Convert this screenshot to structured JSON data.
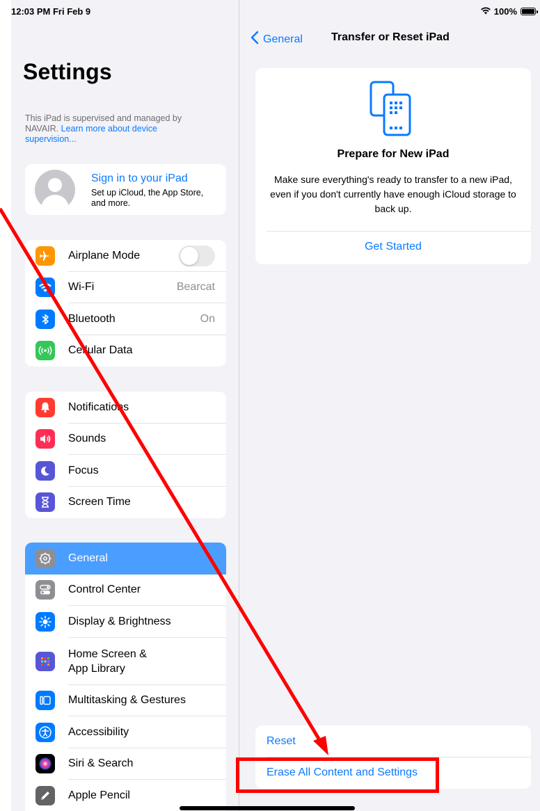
{
  "status_bar": {
    "time": "12:03 PM  Fri Feb 9",
    "battery": "100%"
  },
  "sidebar": {
    "title": "Settings",
    "supervision_text": "This iPad is supervised and managed by NAVAIR.",
    "supervision_link": "Learn more about device supervision...",
    "profile": {
      "title": "Sign in to your iPad",
      "subtitle": "Set up iCloud, the App Store, and more."
    },
    "group1": [
      {
        "label": "Airplane Mode",
        "icon": "airplane-icon",
        "color": "#ff9500",
        "toggle": false
      },
      {
        "label": "Wi-Fi",
        "icon": "wifi-icon",
        "color": "#007aff",
        "value": "Bearcat"
      },
      {
        "label": "Bluetooth",
        "icon": "bluetooth-icon",
        "color": "#007aff",
        "value": "On"
      },
      {
        "label": "Cellular Data",
        "icon": "cellular-icon",
        "color": "#34c759"
      }
    ],
    "group2": [
      {
        "label": "Notifications",
        "icon": "bell-icon",
        "color": "#ff3b30"
      },
      {
        "label": "Sounds",
        "icon": "speaker-icon",
        "color": "#ff2d55"
      },
      {
        "label": "Focus",
        "icon": "moon-icon",
        "color": "#5856d6"
      },
      {
        "label": "Screen Time",
        "icon": "hourglass-icon",
        "color": "#5856d6"
      }
    ],
    "group3": [
      {
        "label": "General",
        "icon": "gear-icon",
        "color": "#8e8e93",
        "selected": true
      },
      {
        "label": "Control Center",
        "icon": "switches-icon",
        "color": "#8e8e93"
      },
      {
        "label": "Display & Brightness",
        "icon": "sun-icon",
        "color": "#007aff"
      },
      {
        "label": "Home Screen &\nApp Library",
        "icon": "home-grid-icon",
        "color": "#5856d6"
      },
      {
        "label": "Multitasking & Gestures",
        "icon": "multitask-icon",
        "color": "#007aff"
      },
      {
        "label": "Accessibility",
        "icon": "accessibility-icon",
        "color": "#007aff"
      },
      {
        "label": "Siri & Search",
        "icon": "siri-icon",
        "color": "#000000"
      },
      {
        "label": "Apple Pencil",
        "icon": "pencil-icon",
        "color": "#636366"
      }
    ]
  },
  "detail": {
    "back_label": "General",
    "title": "Transfer or Reset iPad",
    "prepare": {
      "title": "Prepare for New iPad",
      "description": "Make sure everything's ready to transfer to a new iPad, even if you don't currently have enough iCloud storage to back up.",
      "action": "Get Started"
    },
    "reset_label": "Reset",
    "erase_label": "Erase All Content and Settings"
  },
  "colors": {
    "accent": "#0a7aff",
    "selected_row": "#4a9eff",
    "annotation": "#ff0000"
  }
}
